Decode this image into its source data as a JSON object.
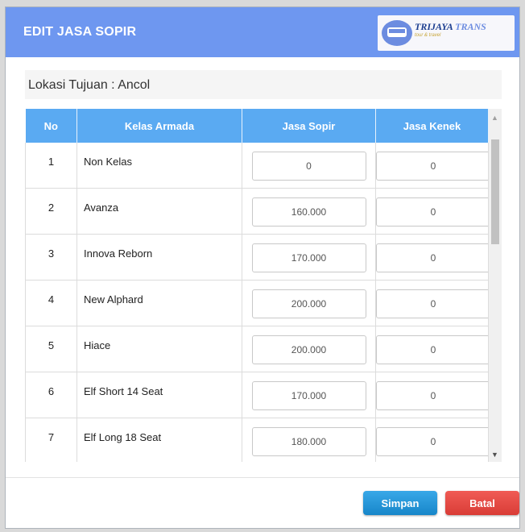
{
  "dialog": {
    "title": "EDIT JASA SOPIR",
    "logo": {
      "brand_primary": "TRIJAYA",
      "brand_secondary": "TRANS",
      "tagline": "tour & travel"
    },
    "location_label": "Lokasi Tujuan : Ancol"
  },
  "table": {
    "headers": [
      "No",
      "Kelas Armada",
      "Jasa Sopir",
      "Jasa Kenek"
    ],
    "rows": [
      {
        "no": "1",
        "kelas": "Non Kelas",
        "sopir": "0",
        "kenek": "0"
      },
      {
        "no": "2",
        "kelas": "Avanza",
        "sopir": "160.000",
        "kenek": "0"
      },
      {
        "no": "3",
        "kelas": "Innova Reborn",
        "sopir": "170.000",
        "kenek": "0"
      },
      {
        "no": "4",
        "kelas": "New Alphard",
        "sopir": "200.000",
        "kenek": "0"
      },
      {
        "no": "5",
        "kelas": "Hiace",
        "sopir": "200.000",
        "kenek": "0"
      },
      {
        "no": "6",
        "kelas": "Elf Short 14 Seat",
        "sopir": "170.000",
        "kenek": "0"
      },
      {
        "no": "7",
        "kelas": "Elf Long 18 Seat",
        "sopir": "180.000",
        "kenek": "0"
      }
    ]
  },
  "buttons": {
    "save": "Simpan",
    "cancel": "Batal"
  },
  "colors": {
    "header": "#6e97f0",
    "table_header": "#5aaaf2",
    "save": "#1e8fd4",
    "cancel": "#e4473f"
  }
}
